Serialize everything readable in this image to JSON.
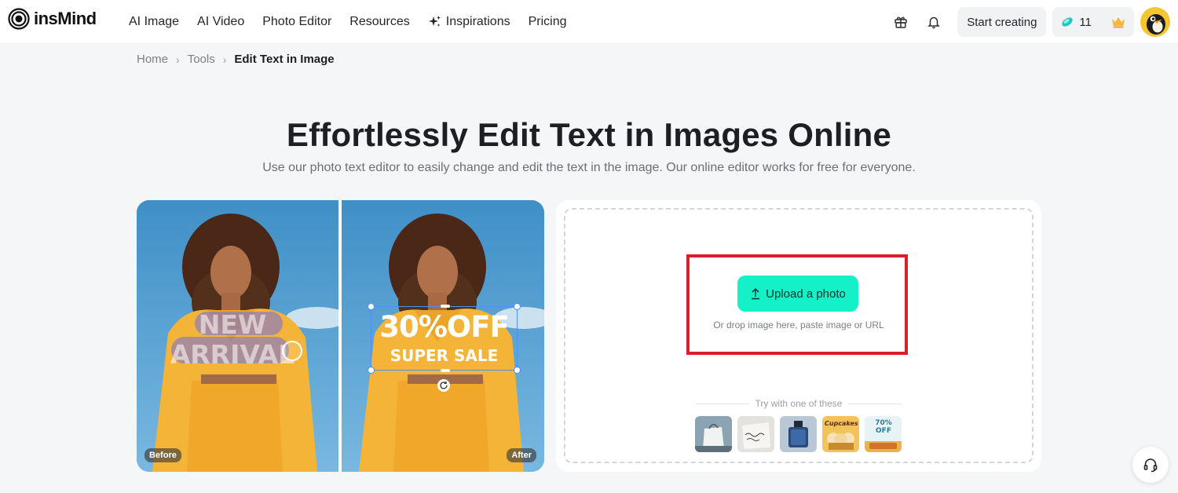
{
  "brand": {
    "name": "insMind"
  },
  "nav": {
    "items": [
      {
        "label": "AI Image"
      },
      {
        "label": "AI Video"
      },
      {
        "label": "Photo Editor"
      },
      {
        "label": "Resources"
      },
      {
        "label": "Inspirations",
        "icon": "sparkle-icon"
      },
      {
        "label": "Pricing"
      }
    ],
    "start_label": "Start creating",
    "credits": "11"
  },
  "breadcrumb": {
    "home": "Home",
    "tools": "Tools",
    "current": "Edit Text in Image"
  },
  "hero": {
    "title": "Effortlessly Edit Text in Images Online",
    "subtitle": "Use our photo text editor to easily change and edit the text in the image. Our online editor works for free for everyone."
  },
  "compare": {
    "before_label": "Before",
    "after_label": "After",
    "before_line1": "NEW",
    "before_line2": "ARRIVAL",
    "after_line1": "30%OFF",
    "after_line2": "SUPER SALE"
  },
  "upload": {
    "button_label": "Upload a photo",
    "hint": "Or drop image here, paste image or URL",
    "try_label": "Try with one of these",
    "samples": [
      {
        "name": "shopping-bag"
      },
      {
        "name": "napkin-script"
      },
      {
        "name": "perfume-bottle",
        "text": ""
      },
      {
        "name": "cupcakes",
        "text": "Cupcakes"
      },
      {
        "name": "sale-poster",
        "text": "70% OFF"
      }
    ]
  },
  "colors": {
    "accent": "#14f0c8",
    "highlight": "#d91f2e",
    "page_bg": "#f5f6f8"
  }
}
